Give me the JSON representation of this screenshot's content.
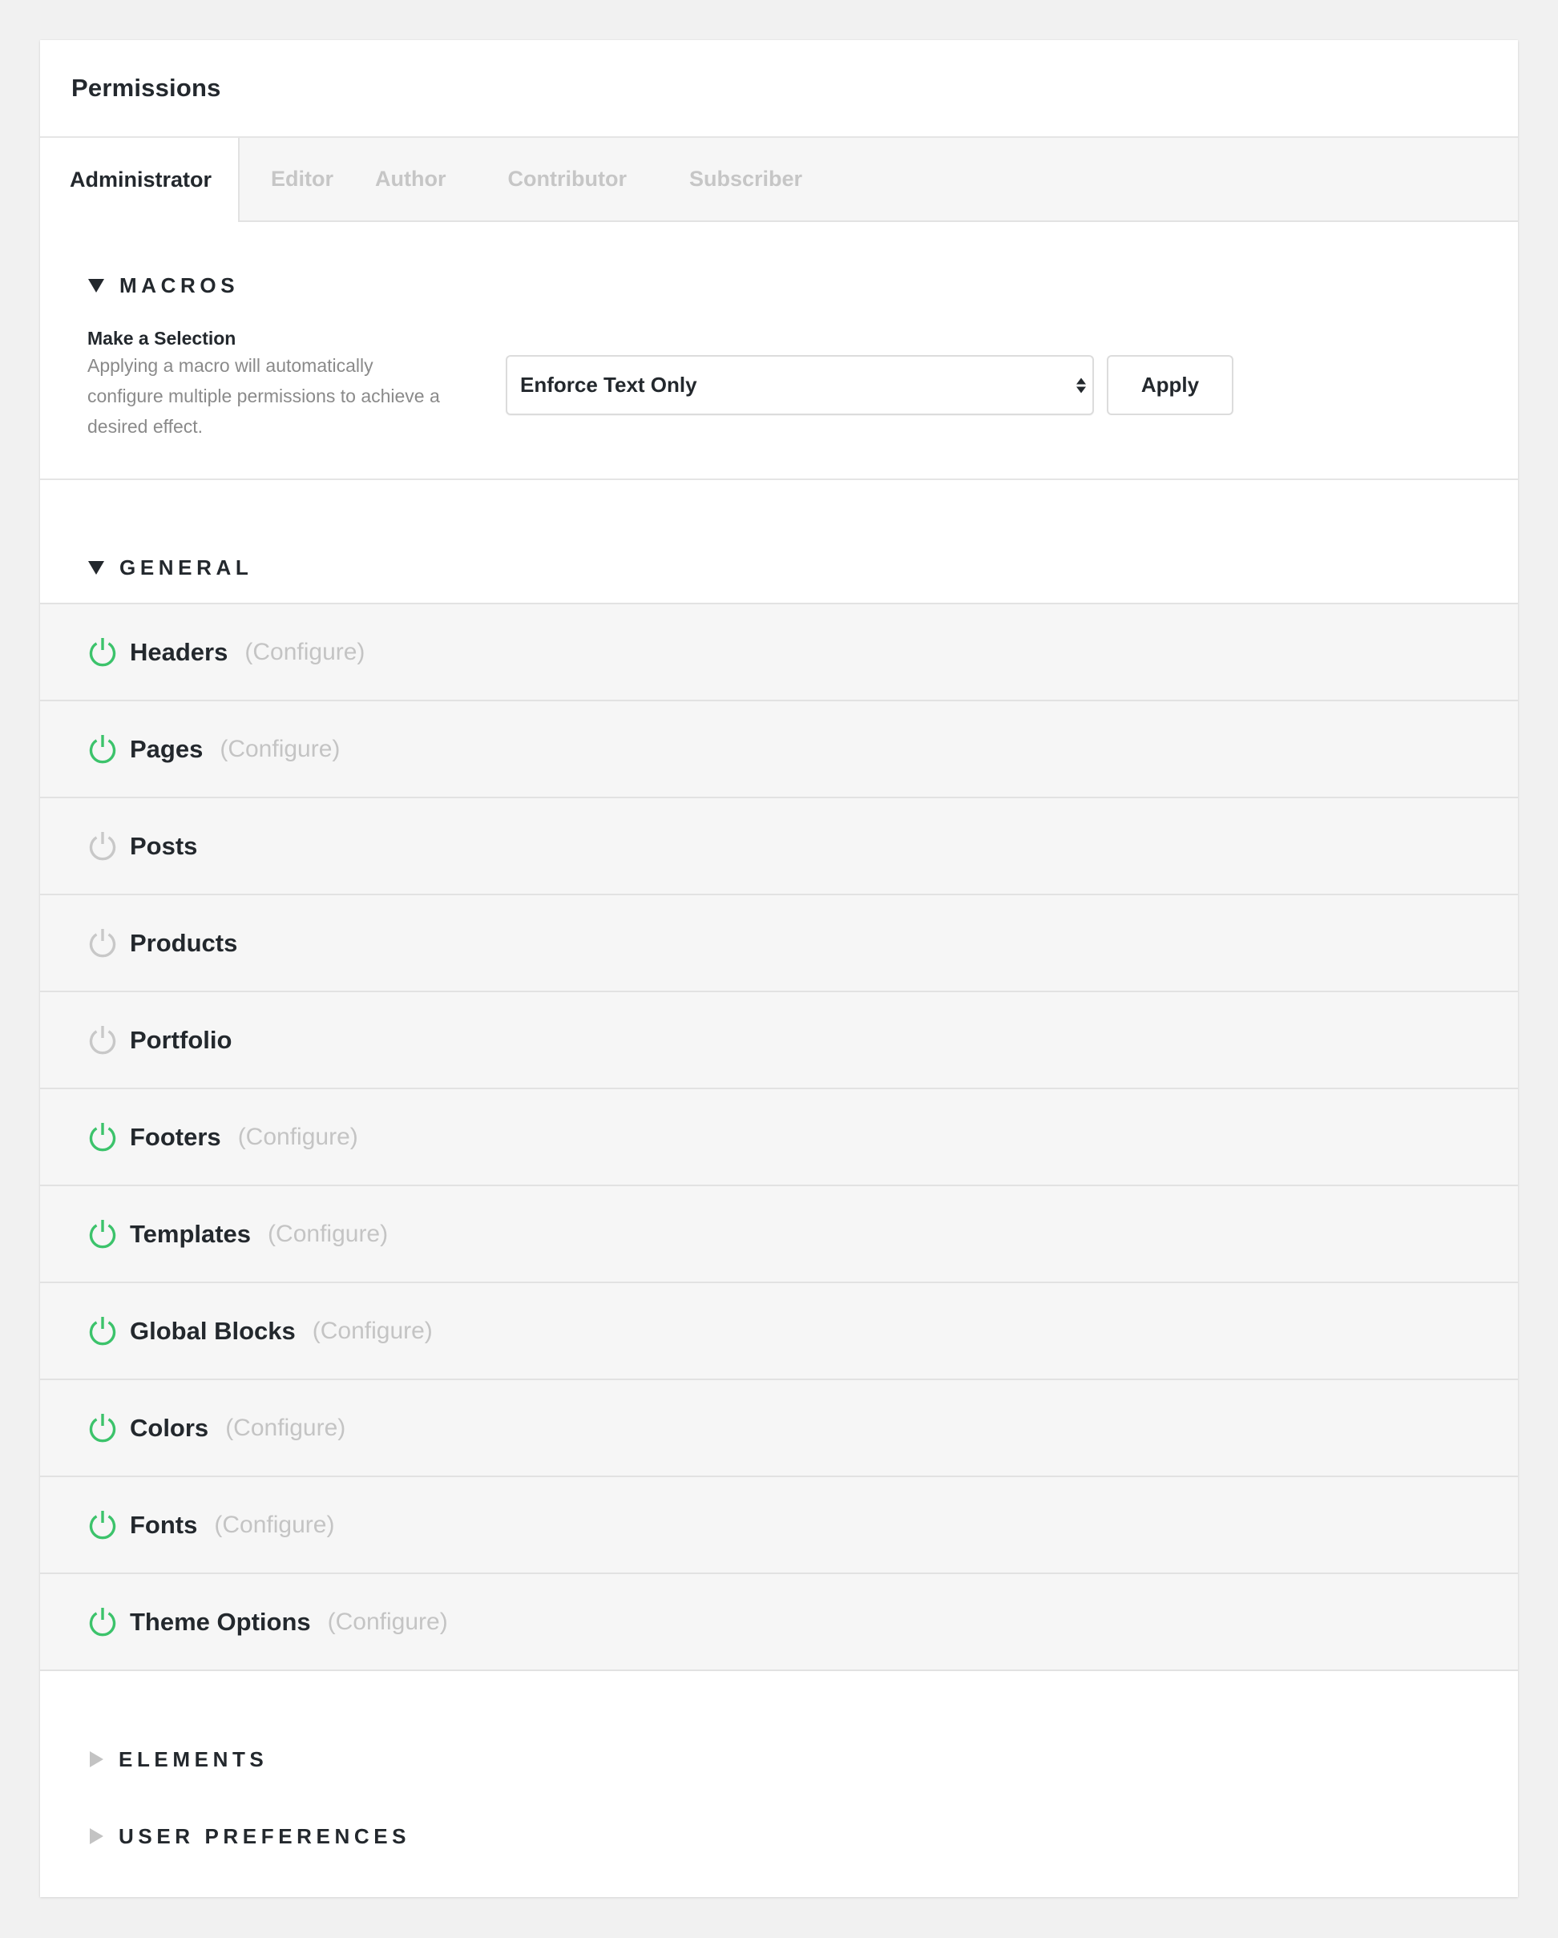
{
  "panel": {
    "title": "Permissions"
  },
  "tabs": [
    {
      "label": "Administrator",
      "active": true
    },
    {
      "label": "Editor",
      "active": false
    },
    {
      "label": "Author",
      "active": false
    },
    {
      "label": "Contributor",
      "active": false
    },
    {
      "label": "Subscriber",
      "active": false
    }
  ],
  "macros": {
    "heading": "MACROS",
    "expanded": true,
    "label": "Make a Selection",
    "description": "Applying a macro will automatically configure multiple permissions to achieve a desired effect.",
    "select_value": "Enforce Text Only",
    "apply_label": "Apply"
  },
  "general": {
    "heading": "GENERAL",
    "expanded": true,
    "configure_label": "(Configure)",
    "items": [
      {
        "label": "Headers",
        "enabled": true,
        "configure": "(Configure)"
      },
      {
        "label": "Pages",
        "enabled": true,
        "configure": "(Configure)"
      },
      {
        "label": "Posts",
        "enabled": false,
        "configure": ""
      },
      {
        "label": "Products",
        "enabled": false,
        "configure": ""
      },
      {
        "label": "Portfolio",
        "enabled": false,
        "configure": ""
      },
      {
        "label": "Footers",
        "enabled": true,
        "configure": "(Configure)"
      },
      {
        "label": "Templates",
        "enabled": true,
        "configure": "(Configure)"
      },
      {
        "label": "Global Blocks",
        "enabled": true,
        "configure": "(Configure)"
      },
      {
        "label": "Colors",
        "enabled": true,
        "configure": "(Configure)"
      },
      {
        "label": "Fonts",
        "enabled": true,
        "configure": "(Configure)"
      },
      {
        "label": "Theme Options",
        "enabled": true,
        "configure": "(Configure)"
      }
    ]
  },
  "elements": {
    "heading": "ELEMENTS",
    "expanded": false
  },
  "user_preferences": {
    "heading": "USER PREFERENCES",
    "expanded": false
  },
  "colors": {
    "enabled": "#3cc36b",
    "disabled": "#c8c8c8",
    "text": "#23282d",
    "muted": "#8a8a8a"
  }
}
